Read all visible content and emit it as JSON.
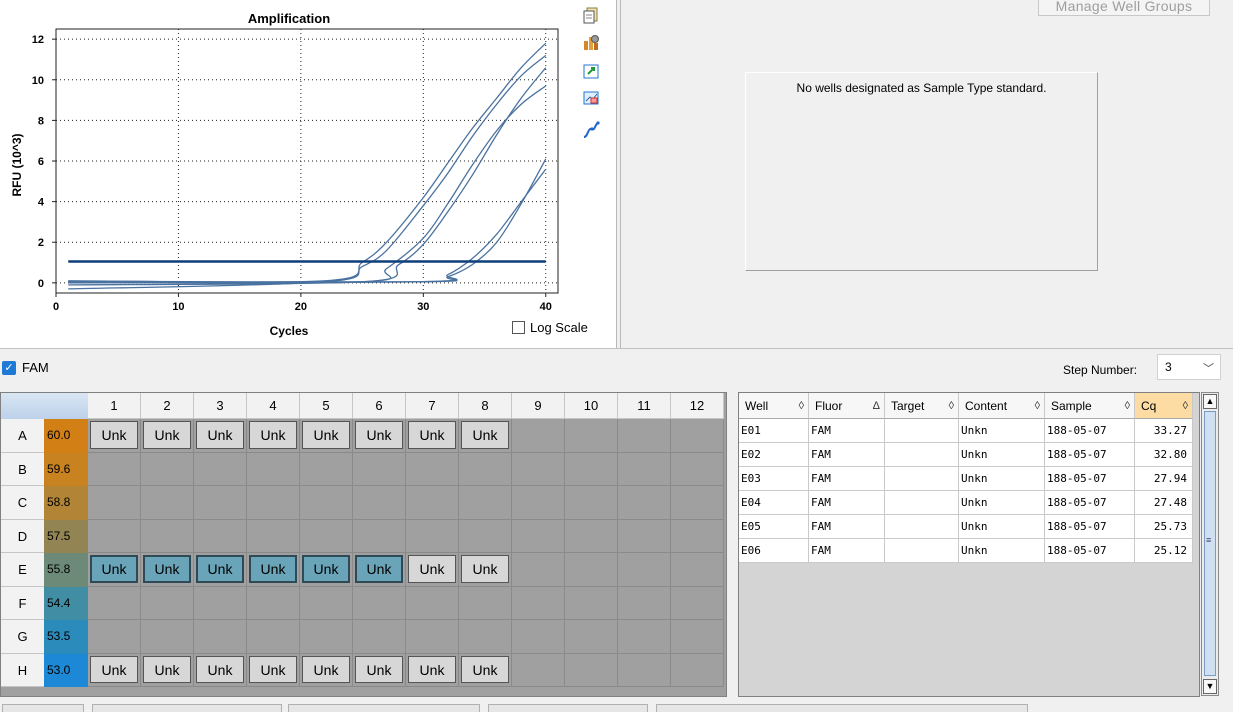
{
  "chart": {
    "title": "Amplification",
    "xlabel": "Cycles",
    "ylabel": "RFU (10^3)",
    "x_ticks": [
      "0",
      "10",
      "20",
      "30",
      "40"
    ],
    "y_ticks": [
      "0",
      "2",
      "4",
      "6",
      "8",
      "10",
      "12"
    ],
    "log_scale_label": "Log Scale",
    "log_scale_checked": false,
    "tool_icons": [
      "copy-icon",
      "chart-settings-icon",
      "export-icon",
      "zoom-icon",
      "curve-icon"
    ]
  },
  "chart_data": {
    "type": "line",
    "title": "Amplification",
    "xlabel": "Cycles",
    "ylabel": "RFU (10^3)",
    "xlim": [
      0,
      41
    ],
    "ylim": [
      -0.5,
      12.5
    ],
    "grid": true,
    "log_scale": false,
    "line_color": "#4a72a0",
    "threshold": {
      "value": 1.05,
      "x_range": [
        1,
        40
      ],
      "color": "#0f3f7a"
    },
    "series": [
      {
        "well": "E01",
        "cq": 33.27,
        "x": [
          1,
          30,
          32,
          34,
          36,
          38,
          40
        ],
        "y": [
          0.08,
          0.05,
          0.3,
          0.9,
          2.0,
          3.9,
          6.1
        ]
      },
      {
        "well": "E02",
        "cq": 32.8,
        "x": [
          1,
          30,
          32,
          34,
          36,
          38,
          40
        ],
        "y": [
          0.0,
          0.06,
          0.4,
          1.2,
          2.4,
          4.0,
          5.6
        ]
      },
      {
        "well": "E03",
        "cq": 27.94,
        "x": [
          1,
          25,
          28,
          30,
          32,
          34,
          36,
          38,
          40
        ],
        "y": [
          0.05,
          0.05,
          0.9,
          1.9,
          3.5,
          5.3,
          7.3,
          9.1,
          10.6
        ]
      },
      {
        "well": "E04",
        "cq": 27.48,
        "x": [
          1,
          25,
          27,
          30,
          32,
          34,
          36,
          38,
          40
        ],
        "y": [
          -0.1,
          0.05,
          0.7,
          2.2,
          3.9,
          5.8,
          7.5,
          8.8,
          9.7
        ]
      },
      {
        "well": "E05",
        "cq": 25.73,
        "x": [
          1,
          22,
          25,
          27,
          30,
          32,
          34,
          36,
          38,
          40
        ],
        "y": [
          -0.3,
          0.05,
          0.8,
          1.6,
          3.8,
          5.4,
          7.2,
          8.8,
          10.2,
          11.2
        ]
      },
      {
        "well": "E06",
        "cq": 25.12,
        "x": [
          1,
          22,
          25,
          27,
          30,
          32,
          34,
          36,
          38,
          40
        ],
        "y": [
          0.1,
          0.1,
          1.0,
          2.0,
          4.2,
          5.9,
          7.6,
          9.1,
          10.6,
          11.8
        ]
      }
    ]
  },
  "standard_curve": {
    "manage_button": "Manage Well Groups",
    "message": "No wells designated as Sample Type standard."
  },
  "fluor": {
    "label": "FAM",
    "checked": true
  },
  "step": {
    "label": "Step Number:",
    "value": "3"
  },
  "plate": {
    "columns": [
      "1",
      "2",
      "3",
      "4",
      "5",
      "6",
      "7",
      "8",
      "9",
      "10",
      "11",
      "12"
    ],
    "rows": [
      {
        "label": "A",
        "temp": "60.0",
        "color": "#d27f16",
        "wells": [
          "Unk",
          "Unk",
          "Unk",
          "Unk",
          "Unk",
          "Unk",
          "Unk",
          "Unk",
          "",
          "",
          "",
          ""
        ],
        "selected": [
          false,
          false,
          false,
          false,
          false,
          false,
          false,
          false,
          false,
          false,
          false,
          false
        ]
      },
      {
        "label": "B",
        "temp": "59.6",
        "color": "#c8821f",
        "wells": [
          "",
          "",
          "",
          "",
          "",
          "",
          "",
          "",
          "",
          "",
          "",
          ""
        ],
        "selected": [
          false,
          false,
          false,
          false,
          false,
          false,
          false,
          false,
          false,
          false,
          false,
          false
        ]
      },
      {
        "label": "C",
        "temp": "58.8",
        "color": "#b28436",
        "wells": [
          "",
          "",
          "",
          "",
          "",
          "",
          "",
          "",
          "",
          "",
          "",
          ""
        ],
        "selected": [
          false,
          false,
          false,
          false,
          false,
          false,
          false,
          false,
          false,
          false,
          false,
          false
        ]
      },
      {
        "label": "D",
        "temp": "57.5",
        "color": "#928553",
        "wells": [
          "",
          "",
          "",
          "",
          "",
          "",
          "",
          "",
          "",
          "",
          "",
          ""
        ],
        "selected": [
          false,
          false,
          false,
          false,
          false,
          false,
          false,
          false,
          false,
          false,
          false,
          false
        ]
      },
      {
        "label": "E",
        "temp": "55.8",
        "color": "#6c8a77",
        "wells": [
          "Unk",
          "Unk",
          "Unk",
          "Unk",
          "Unk",
          "Unk",
          "Unk",
          "Unk",
          "",
          "",
          "",
          ""
        ],
        "selected": [
          true,
          true,
          true,
          true,
          true,
          true,
          false,
          false,
          false,
          false,
          false,
          false
        ]
      },
      {
        "label": "F",
        "temp": "54.4",
        "color": "#418da3",
        "wells": [
          "",
          "",
          "",
          "",
          "",
          "",
          "",
          "",
          "",
          "",
          "",
          ""
        ],
        "selected": [
          false,
          false,
          false,
          false,
          false,
          false,
          false,
          false,
          false,
          false,
          false,
          false
        ]
      },
      {
        "label": "G",
        "temp": "53.5",
        "color": "#2b8cbb",
        "wells": [
          "",
          "",
          "",
          "",
          "",
          "",
          "",
          "",
          "",
          "",
          "",
          ""
        ],
        "selected": [
          false,
          false,
          false,
          false,
          false,
          false,
          false,
          false,
          false,
          false,
          false,
          false
        ]
      },
      {
        "label": "H",
        "temp": "53.0",
        "color": "#1c88d6",
        "wells": [
          "Unk",
          "Unk",
          "Unk",
          "Unk",
          "Unk",
          "Unk",
          "Unk",
          "Unk",
          "",
          "",
          "",
          ""
        ],
        "selected": [
          false,
          false,
          false,
          false,
          false,
          false,
          false,
          false,
          false,
          false,
          false,
          false
        ]
      }
    ]
  },
  "table": {
    "columns": [
      {
        "label": "Well",
        "sort": "◊"
      },
      {
        "label": "Fluor",
        "sort": "Δ"
      },
      {
        "label": "Target",
        "sort": "◊"
      },
      {
        "label": "Content",
        "sort": "◊"
      },
      {
        "label": "Sample",
        "sort": "◊"
      },
      {
        "label": "Cq",
        "sort": "◊"
      }
    ],
    "rows": [
      [
        "E01",
        "FAM",
        "",
        "Unkn",
        "188-05-07",
        "33.27"
      ],
      [
        "E02",
        "FAM",
        "",
        "Unkn",
        "188-05-07",
        "32.80"
      ],
      [
        "E03",
        "FAM",
        "",
        "Unkn",
        "188-05-07",
        "27.94"
      ],
      [
        "E04",
        "FAM",
        "",
        "Unkn",
        "188-05-07",
        "27.48"
      ],
      [
        "E05",
        "FAM",
        "",
        "Unkn",
        "188-05-07",
        "25.73"
      ],
      [
        "E06",
        "FAM",
        "",
        "Unkn",
        "188-05-07",
        "25.12"
      ]
    ]
  }
}
